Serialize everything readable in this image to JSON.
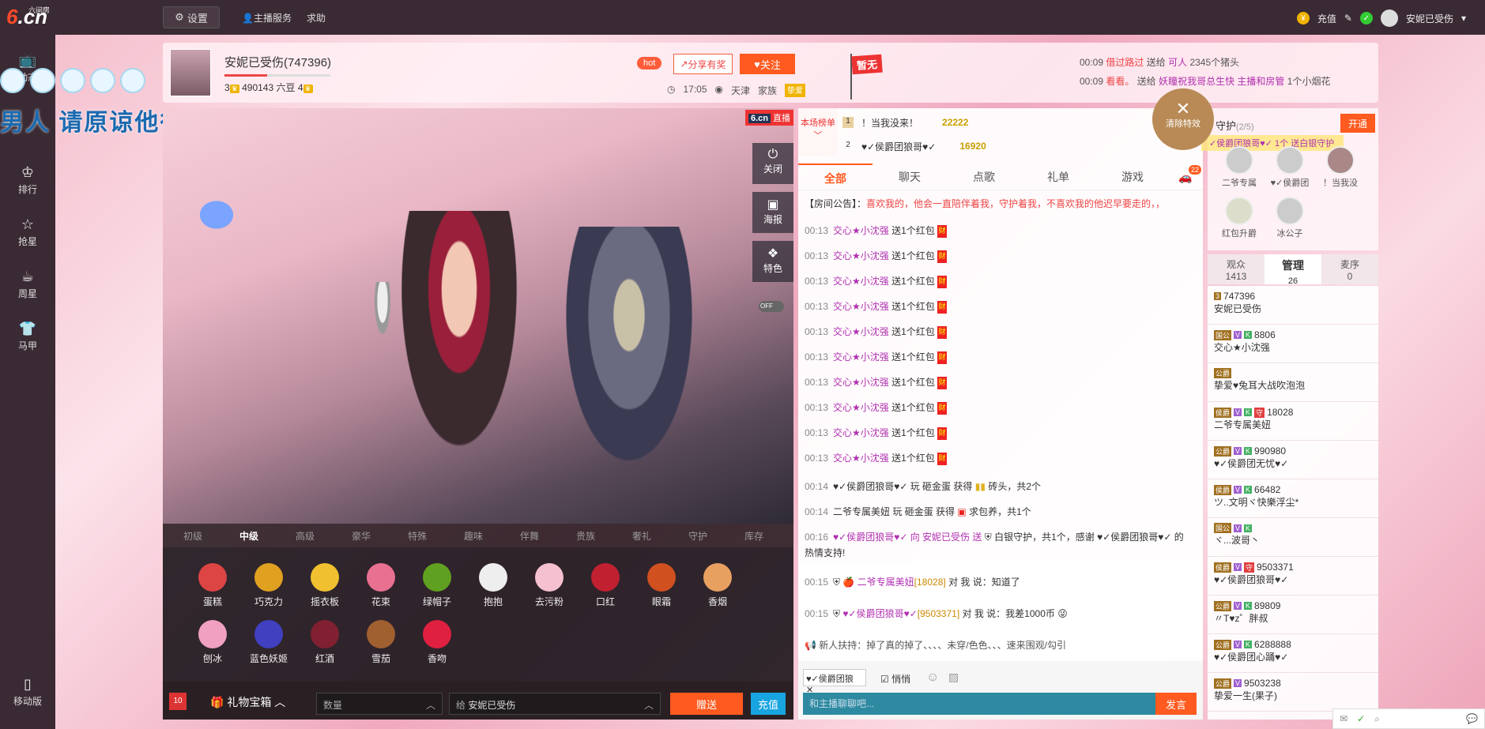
{
  "topbar": {
    "logo_main": "6.cn",
    "logo_small": "六间房",
    "settings_label": "设置",
    "anchor_service": "主播服务",
    "help": "求助",
    "recharge": "充值",
    "username": "安妮已受伤"
  },
  "sidebar": {
    "items": [
      {
        "label": "动态",
        "icon": "tv-icon"
      },
      {
        "label": "排行",
        "icon": "crown-icon"
      },
      {
        "label": "抢星",
        "icon": "star-icon"
      },
      {
        "label": "周星",
        "icon": "cup-icon"
      },
      {
        "label": "马甲",
        "icon": "shirt-icon"
      }
    ],
    "mobile": "移动版"
  },
  "overlay_text": "男人 请原谅他很平凡",
  "header": {
    "anchor_name": "安妮已受伤(747396)",
    "level_left": "3",
    "beans": "490143 六豆",
    "level_right": "4",
    "hot": "hot",
    "share": "分享有奖",
    "follow": "关注",
    "time": "17:05",
    "city": "天津",
    "family": "家族",
    "family_badge": "挚爱",
    "flag": "暂无",
    "ticker": [
      {
        "time": "00:09",
        "from": "借过路过",
        "verb": "送给",
        "to": "可人",
        "gift": "2345个猪头"
      },
      {
        "time": "00:09",
        "from": "看看。",
        "verb": "送给",
        "to": "妖瞳祝我哥总生快 主播和房管",
        "gift": "1个小烟花"
      }
    ]
  },
  "video": {
    "brand": "6.cn",
    "live": "直播",
    "controls": [
      {
        "label": "关闭",
        "icon": "power-icon"
      },
      {
        "label": "海报",
        "icon": "poster-icon"
      },
      {
        "label": "特色",
        "icon": "feature-icon"
      }
    ],
    "off_label": "OFF"
  },
  "gift_tabs": [
    "初级",
    "中级",
    "高级",
    "豪华",
    "特殊",
    "趣味",
    "伴舞",
    "贵族",
    "奢礼",
    "守护",
    "库存"
  ],
  "gifts_row1": [
    {
      "label": "蛋糕",
      "color": "#d44"
    },
    {
      "label": "巧克力",
      "color": "#e0a020"
    },
    {
      "label": "摇衣板",
      "color": "#f0c030"
    },
    {
      "label": "花束",
      "color": "#e87090"
    },
    {
      "label": "绿帽子",
      "color": "#60a020"
    },
    {
      "label": "抱抱",
      "color": "#eee"
    },
    {
      "label": "去污粉",
      "color": "#f5c0d0"
    },
    {
      "label": "口红",
      "color": "#c02030"
    },
    {
      "label": "眼霜",
      "color": "#d05020"
    },
    {
      "label": "香烟",
      "color": "#e8a060"
    }
  ],
  "gifts_row2": [
    {
      "label": "刨冰",
      "color": "#f0a0c0"
    },
    {
      "label": "蓝色妖姬",
      "color": "#4040c0"
    },
    {
      "label": "红酒",
      "color": "#802030"
    },
    {
      "label": "雪茄",
      "color": "#a06030"
    },
    {
      "label": "香吻",
      "color": "#e02040"
    }
  ],
  "gift_bar": {
    "wealth": "10",
    "gift_box": "礼物宝箱",
    "quantity_placeholder": "数量",
    "to_prefix": "给",
    "to_name": "安妮已受伤",
    "send": "赠送",
    "recharge": "充值"
  },
  "rank": {
    "title": "本场榜单",
    "rows": [
      {
        "num": "1",
        "name": "！当我没来！",
        "score": "22222"
      },
      {
        "num": "2",
        "name": "♥✓侯爵团狼哥♥✓",
        "score": "16920"
      }
    ]
  },
  "chat_tabs": [
    "全部",
    "聊天",
    "点歌",
    "礼单",
    "游戏"
  ],
  "chat_badge": "22",
  "notice_label": "【房间公告】：",
  "notice": "喜欢我的，他会一直陪伴着我，守护着我，不喜欢我的他迟早要走的，，",
  "messages": [
    {
      "time": "00:13",
      "user": "交心★小沈强",
      "text": "送1个红包"
    },
    {
      "time": "00:13",
      "user": "交心★小沈强",
      "text": "送1个红包"
    },
    {
      "time": "00:13",
      "user": "交心★小沈强",
      "text": "送1个红包"
    },
    {
      "time": "00:13",
      "user": "交心★小沈强",
      "text": "送1个红包"
    },
    {
      "time": "00:13",
      "user": "交心★小沈强",
      "text": "送1个红包"
    },
    {
      "time": "00:13",
      "user": "交心★小沈强",
      "text": "送1个红包"
    },
    {
      "time": "00:13",
      "user": "交心★小沈强",
      "text": "送1个红包"
    },
    {
      "time": "00:13",
      "user": "交心★小沈强",
      "text": "送1个红包"
    },
    {
      "time": "00:13",
      "user": "交心★小沈强",
      "text": "送1个红包"
    },
    {
      "time": "00:13",
      "user": "交心★小沈强",
      "text": "送1个红包"
    }
  ],
  "msg_red_char": "财",
  "events": [
    {
      "time": "00:14",
      "text": "♥✓侯爵团狼哥♥✓ 玩 砸金蛋 获得",
      "tail": "砖头，共2个"
    },
    {
      "time": "00:14",
      "text": "二爷专属美妞 玩 砸金蛋 获得",
      "tail": "求包养，共1个"
    },
    {
      "time": "00:16",
      "text": "♥✓侯爵团狼哥♥✓ 向 安妮已受伤 送",
      "tail": "白银守护，共1个，感谢 ♥✓侯爵团狼哥♥✓ 的"
    },
    {
      "time": "",
      "text": "热情支持!",
      "tail": ""
    }
  ],
  "lower_chat": [
    {
      "time": "00:15",
      "user": "二爷专属美妞",
      "id": "[18028]",
      "to": "对 我 说：",
      "text": "知道了"
    },
    {
      "time": "00:15",
      "user": "♥✓侯爵团狼哥♥✓",
      "id": "[9503371]",
      "to": "对 我 说：",
      "text": "我差1000币"
    }
  ],
  "newbie_line": "新人扶持：掉了真的掉了、、、、未穿/色色、、、速来围观/勾引",
  "chat_input": {
    "target": "♥✓侯爵团狼",
    "whisper": "悄悄",
    "placeholder": "和主播聊聊吧...",
    "send": "发言"
  },
  "guard": {
    "title": "守护",
    "count": "(2/5)",
    "open": "开通",
    "clear_fx": "清除特效",
    "banner": "✓侯爵团狼哥♥✓ 1个 送白银守护",
    "members": [
      "二爷专属",
      "♥✓侯爵团",
      "！当我没",
      "红包升爵",
      "冰公子"
    ]
  },
  "user_tabs": [
    {
      "label": "观众",
      "count": "1413"
    },
    {
      "label": "管理",
      "count": "26"
    },
    {
      "label": "麦序",
      "count": "0"
    }
  ],
  "users": [
    {
      "tags": [
        "3"
      ],
      "id": "747396",
      "name": "安妮已受伤"
    },
    {
      "tags": [
        "国公",
        "V",
        "K"
      ],
      "id": "8806",
      "name": "交心★小沈强"
    },
    {
      "tags": [
        "公爵"
      ],
      "id": "",
      "name": "挚爱♥兔耳大战吹泡泡"
    },
    {
      "tags": [
        "侯爵",
        "V",
        "K",
        "守"
      ],
      "id": "18028",
      "name": "二爷专属美妞"
    },
    {
      "tags": [
        "公爵",
        "V",
        "K"
      ],
      "id": "990980",
      "name": "♥✓侯爵团无忧♥✓"
    },
    {
      "tags": [
        "侯爵",
        "V",
        "K"
      ],
      "id": "66482",
      "name": "ツ..文明ヾ快樂浮尘*"
    },
    {
      "tags": [
        "国公",
        "V",
        "K"
      ],
      "id": "",
      "name": "ヾ...波哥丶"
    },
    {
      "tags": [
        "侯爵",
        "V",
        "守"
      ],
      "id": "9503371",
      "name": "♥✓侯爵团狼哥♥✓"
    },
    {
      "tags": [
        "公爵",
        "V",
        "K"
      ],
      "id": "89809",
      "name": "〃T♥z゜胖叔"
    },
    {
      "tags": [
        "公爵",
        "V",
        "K"
      ],
      "id": "6288888",
      "name": "♥✓侯爵团心踊♥✓"
    },
    {
      "tags": [
        "公爵",
        "V"
      ],
      "id": "9503238",
      "name": "挚爱一生(果子)"
    }
  ],
  "colors": {
    "accent": "#ff5a1f",
    "topbar": "#3a2a34",
    "guard_button": "#18a4e0"
  }
}
